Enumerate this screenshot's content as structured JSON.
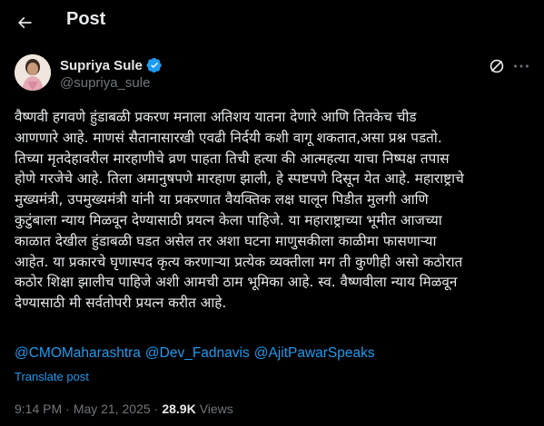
{
  "header": {
    "title": "Post",
    "back_icon": "arrow-left-icon"
  },
  "author": {
    "name": "Supriya Sule",
    "handle": "@supriya_sule",
    "verified_color": "#1d9bf0"
  },
  "post": {
    "lines": [
      "वैष्णवी हगवणे हुंडाबळी प्रकरण मनाला अतिशय यातना देणारे आणि तितकेच चीड",
      "आणणारे आहे. माणसं सैतानासारखी एवढी निर्दयी कशी वागू शकतात,असा प्रश्न पडतो.",
      "तिच्या मृतदेहावरील मारहाणीचे व्रण पाहता तिची हत्या की आत्महत्या याचा निष्पक्ष तपास",
      "होणे गरजेचे आहे. तिला अमानुषपणे मारहाण झाली, हे स्पष्टपणे दिसून येत आहे. महाराष्ट्राचे",
      "मुख्यमंत्री, उपमुख्यमंत्री यांनी या प्रकरणात वैयक्तिक लक्ष घालून पिडीत मुलगी आणि",
      "कुटुंबाला न्याय मिळवून देण्यासाठी प्रयत्न केला पाहिजे. या महाराष्ट्राच्या भूमीत आजच्या",
      "काळात देखील हुंडाबळी घडत असेल तर अशा घटना माणुसकीला काळीमा फासणाऱ्या",
      "आहेत. या प्रकारचे घृणास्पद कृत्य करणाऱ्या प्रत्येक व्यक्तीला मग ती कुणीही असो कठोरात",
      "कठोर शिक्षा झालीच पाहिजे अशी आमची ठाम भूमिका आहे. स्व. वैष्णवीला न्याय मिळवून",
      "देण्यासाठी मी सर्वतोपरी प्रयत्न करीत आहे."
    ],
    "mentions": [
      "@CMOMaharashtra",
      "@Dev_Fadnavis",
      "@AjitPawarSpeaks"
    ],
    "translate_label": "Translate post"
  },
  "meta": {
    "time": "9:14 PM",
    "separator": "·",
    "date": "May 21, 2025",
    "views_count": "28.9K",
    "views_label": "Views"
  },
  "icons": {
    "grok": "grok-icon",
    "more": "more-options-icon"
  },
  "colors": {
    "background": "#000000",
    "text": "#e7e9ea",
    "secondary": "#71767b",
    "link": "#1d9bf0"
  }
}
